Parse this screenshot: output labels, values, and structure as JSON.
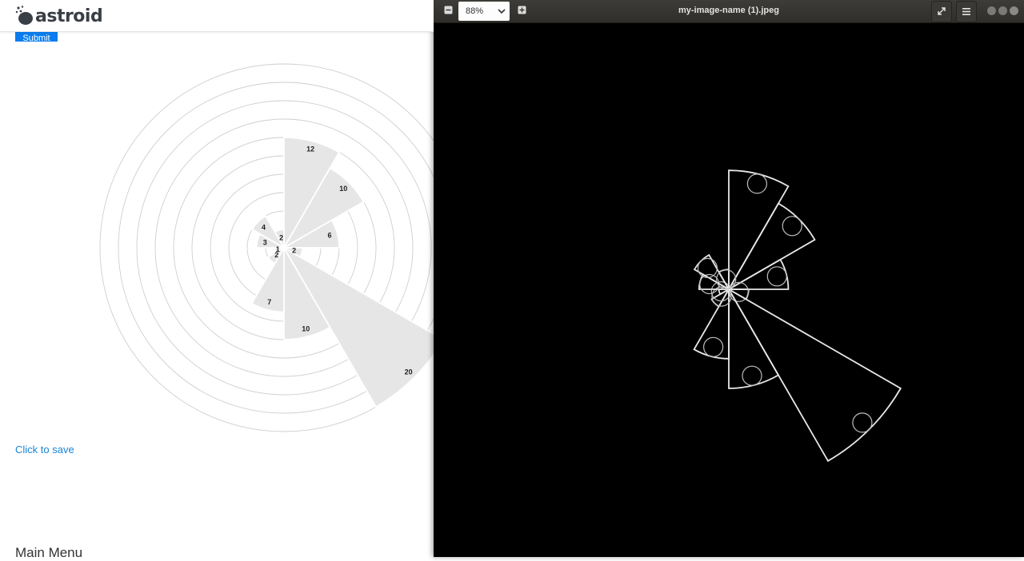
{
  "brand": {
    "name": "astroid"
  },
  "page": {
    "submit_label": "Submit",
    "save_link": "Click to save",
    "menu_heading": "Main Menu"
  },
  "viewer": {
    "title": "my-image-name (1).jpeg",
    "zoom": "88%",
    "zoom_out_icon": "minus-icon",
    "zoom_in_icon": "plus-icon",
    "fullscreen_icon": "expand-icon",
    "menu_icon": "hamburger-icon"
  },
  "colors": {
    "accent": "#0b7df0",
    "link": "#1a84d6",
    "wedge": "#e6e6e6"
  },
  "chart_data": {
    "type": "polar-area",
    "rings": 10,
    "labels": [
      "12",
      "10",
      "6",
      "2",
      "20",
      "10",
      "7",
      "2",
      "1",
      "3",
      "4",
      "2"
    ],
    "values": [
      12,
      10,
      6,
      2,
      20,
      10,
      7,
      2,
      1,
      3,
      4,
      2
    ]
  }
}
